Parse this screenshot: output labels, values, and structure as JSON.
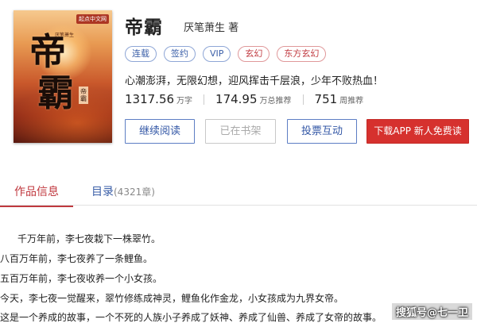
{
  "cover": {
    "publisher": "起点中文网",
    "big_char_1": "帝",
    "big_char_2": "霸",
    "small_title": "帝霸",
    "mini_text": "厌笔萧生"
  },
  "book": {
    "title": "帝霸",
    "author": "厌笔萧生 著",
    "intro": "心潮澎湃，无限幻想，迎风挥击千层浪，少年不败热血！"
  },
  "tags": [
    {
      "label": "连载",
      "style": "blue"
    },
    {
      "label": "签约",
      "style": "blue"
    },
    {
      "label": "VIP",
      "style": "blue"
    },
    {
      "label": "玄幻",
      "style": "red"
    },
    {
      "label": "东方玄幻",
      "style": "red"
    }
  ],
  "stats": [
    {
      "value": "1317.56",
      "unit": "万字"
    },
    {
      "value": "174.95",
      "unit": "万总推荐"
    },
    {
      "value": "751",
      "unit": "周推荐"
    }
  ],
  "buttons": {
    "read": "继续阅读",
    "shelf": "已在书架",
    "vote": "投票互动",
    "download": "下载APP  新人免费读"
  },
  "tabs": {
    "info": "作品信息",
    "directory": "目录",
    "directory_count": "(4321章)"
  },
  "description": [
    "千万年前，李七夜栽下一株翠竹。",
    "八百万年前，李七夜养了一条鲤鱼。",
    "五百万年前，李七夜收养一个小女孩。",
    "今天，李七夜一觉醒来，翠竹修练成神灵，鲤鱼化作金龙，小女孩成为九界女帝。",
    "这是一个养成的故事，一个不死的人族小子养成了妖神、养成了仙兽、养成了女帝的故事。"
  ],
  "watermark": "搜狐号@七一卫",
  "colors": {
    "accent_red": "#c0393f",
    "accent_blue": "#3b5fa8",
    "download_bg": "#d6312e"
  }
}
